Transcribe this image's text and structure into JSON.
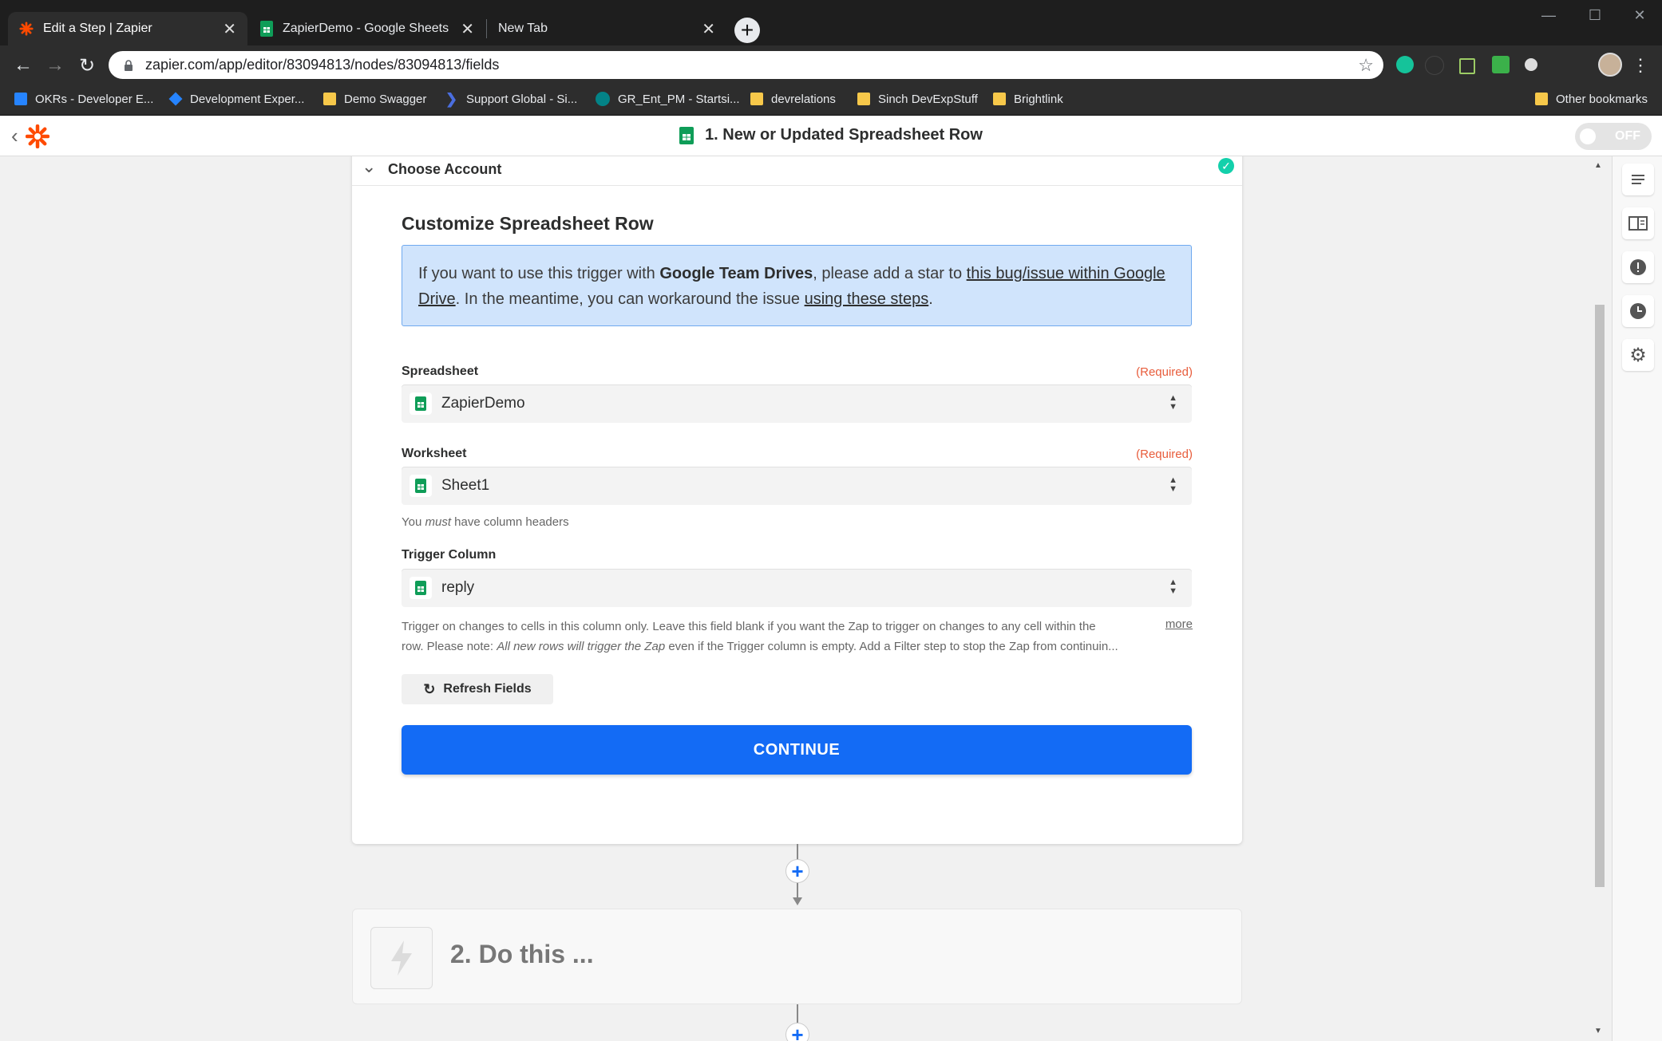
{
  "browser": {
    "tabs": [
      {
        "title": "Edit a Step | Zapier",
        "active": true
      },
      {
        "title": "ZapierDemo - Google Sheets",
        "active": false
      },
      {
        "title": "New Tab",
        "active": false
      }
    ],
    "url": "zapier.com/app/editor/83094813/nodes/83094813/fields",
    "bookmarks": [
      {
        "label": "OKRs - Developer E..."
      },
      {
        "label": "Development Exper..."
      },
      {
        "label": "Demo Swagger"
      },
      {
        "label": "Support Global - Si..."
      },
      {
        "label": "GR_Ent_PM - Startsi..."
      },
      {
        "label": "devrelations"
      },
      {
        "label": "Sinch DevExpStuff"
      },
      {
        "label": "Brightlink"
      },
      {
        "label": "Other bookmarks"
      }
    ]
  },
  "header": {
    "title": "1. New or Updated Spreadsheet Row",
    "toggle_label": "OFF"
  },
  "account": {
    "label": "Choose Account"
  },
  "form": {
    "title": "Customize Spreadsheet Row",
    "notice": {
      "part1": "If you want to use this trigger with ",
      "bold": "Google Team Drives",
      "part2": ", please add a star to ",
      "link1": "this bug/issue within Google Drive",
      "part3": ". In the meantime, you can workaround the issue ",
      "link2": "using these steps",
      "part4": "."
    },
    "spreadsheet": {
      "label": "Spreadsheet",
      "required": "(Required)",
      "value": "ZapierDemo"
    },
    "worksheet": {
      "label": "Worksheet",
      "required": "(Required)",
      "value": "Sheet1",
      "help_pre": "You ",
      "help_em": "must",
      "help_post": " have column headers"
    },
    "trigger_column": {
      "label": "Trigger Column",
      "value": "reply",
      "help_line1": "Trigger on changes to cells in this column only. Leave this field blank if you want the Zap to trigger on changes to any cell within the",
      "help_line2_pre": "row. Please note: ",
      "help_line2_em": "All new rows will trigger the Zap",
      "help_line2_post": " even if the Trigger column is empty. Add a Filter step to stop the Zap from continuin...",
      "more": "more"
    },
    "refresh_label": "Refresh Fields",
    "continue_label": "CONTINUE"
  },
  "step2": {
    "label": "2. Do this ..."
  }
}
